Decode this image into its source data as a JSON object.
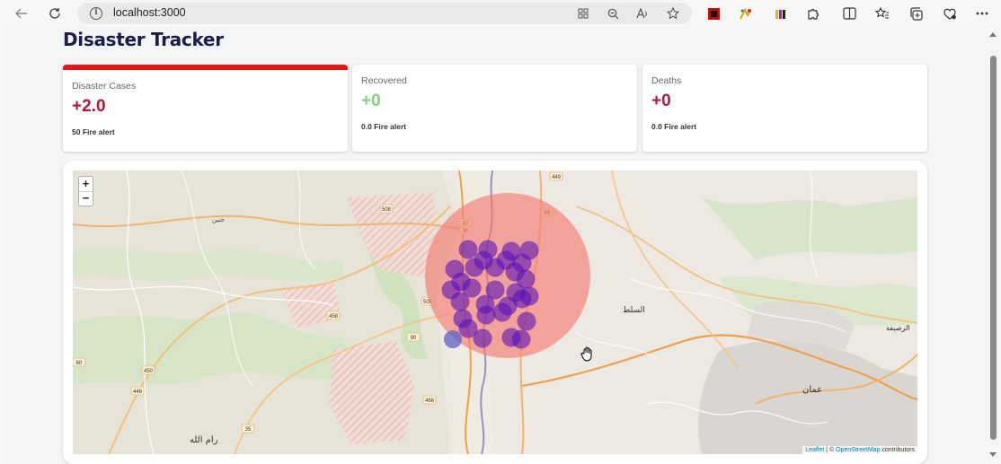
{
  "browser": {
    "url": "localhost:3000",
    "nav_icons": [
      "back-arrow-icon",
      "refresh-icon"
    ],
    "address_icons": [
      "app-grid-icon",
      "zoom-out-icon",
      "read-aloud-icon",
      "favorite-star-icon"
    ],
    "toolbar_icons": [
      "extension-red-icon",
      "extension-color-icon",
      "extension-bars-icon",
      "puzzle-extensions-icon",
      "split-screen-icon",
      "favorites-icon",
      "collections-icon",
      "browser-essentials-icon",
      "more-menu-icon"
    ]
  },
  "page": {
    "title": "Disaster Tracker"
  },
  "cards": [
    {
      "label": "Disaster Cases",
      "value": "+2.0",
      "subtitle": "50 Fire alert",
      "value_color": "#b0173e",
      "selected": true
    },
    {
      "label": "Recovered",
      "value": "+0",
      "subtitle": "0.0 Fire alert",
      "value_color": "#7fd17f",
      "selected": false
    },
    {
      "label": "Deaths",
      "value": "+0",
      "subtitle": "0.0 Fire alert",
      "value_color": "#b0173e",
      "selected": false
    }
  ],
  "map": {
    "zoom_in": "+",
    "zoom_out": "−",
    "attribution_leaflet": "Leaflet",
    "attribution_sep": " | © ",
    "attribution_osm": "OpenStreetMap",
    "attribution_tail": " contributors",
    "highlight_color": "#f47c72",
    "marker_color": "#5a10b8",
    "labels": {
      "salt": "السلط",
      "amman": "عمان",
      "ramallah": "رام الله",
      "rusaifa": "الرصيفة",
      "jenin": "جنين"
    },
    "road_numbers": [
      "508",
      "505",
      "458",
      "90",
      "57",
      "30",
      "65",
      "449",
      "466",
      "450",
      "446",
      "60",
      "35"
    ]
  }
}
